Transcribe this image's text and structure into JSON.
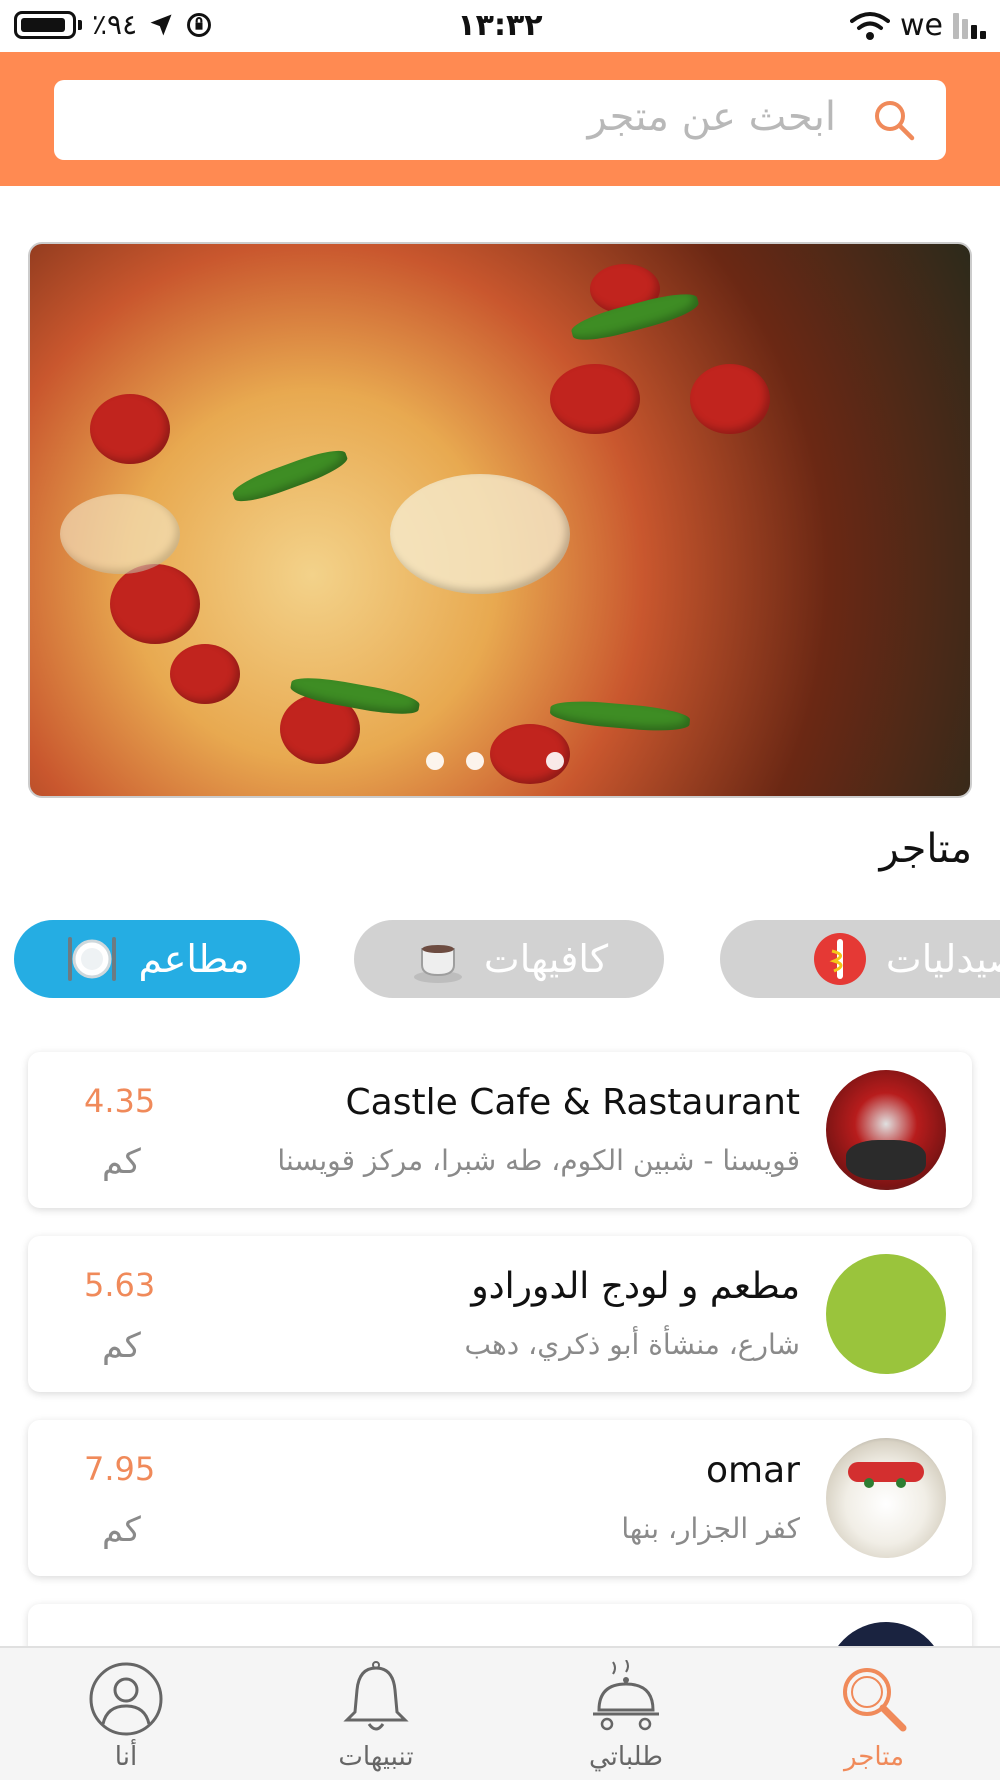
{
  "status_bar": {
    "battery": "٪٩٤",
    "time": "١٣:٣٢",
    "carrier": "we"
  },
  "search": {
    "placeholder": "ابحث عن متجر"
  },
  "section_title": "متاجر",
  "categories": [
    {
      "label": "مطاعم",
      "active": true,
      "icon": "plate-cutlery-icon"
    },
    {
      "label": "كافيهات",
      "active": false,
      "icon": "coffee-cup-icon"
    },
    {
      "label": "صيدليات",
      "active": false,
      "icon": "pharmacy-icon"
    }
  ],
  "stores": [
    {
      "name": "Castle Cafe & Rastaurant",
      "address": "قويسنا - شبين الكوم، طه شبرا، مركز قويسنا",
      "distance": "4.35",
      "unit": "كم"
    },
    {
      "name": "مطعم و لودج الدورادو",
      "address": "شارع، منشأة أبو ذكري، دهب",
      "distance": "5.63",
      "unit": "كم"
    },
    {
      "name": "omar",
      "address": "كفر الجزار، بنها",
      "distance": "7.95",
      "unit": "كم"
    }
  ],
  "tabs": [
    {
      "label": "متاجر",
      "icon": "search-icon",
      "active": true
    },
    {
      "label": "طلباتي",
      "icon": "food-tray-icon",
      "active": false
    },
    {
      "label": "تنبيهات",
      "icon": "bell-icon",
      "active": false
    },
    {
      "label": "أنا",
      "icon": "user-icon",
      "active": false
    }
  ],
  "colors": {
    "accent": "#ff8a52",
    "chip_active": "#25ade3",
    "chip_inactive": "#d2d2d2",
    "distance": "#f08a5a"
  },
  "carousel": {
    "count": 3,
    "active_index": 2
  }
}
